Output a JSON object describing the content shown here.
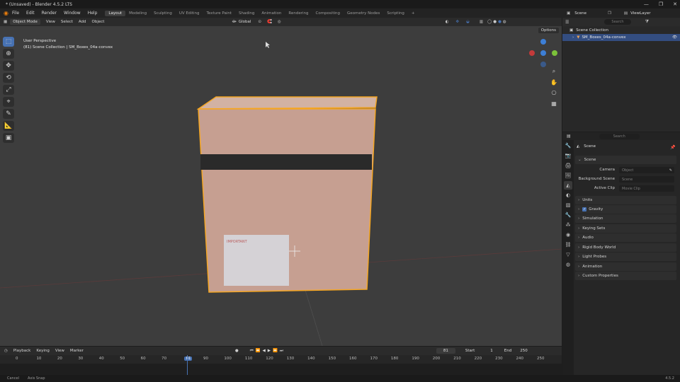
{
  "window": {
    "title": "* (Unsaved) - Blender 4.5.2 LTS",
    "controls": [
      "—",
      "❐",
      "✕"
    ]
  },
  "menu": {
    "items": [
      "File",
      "Edit",
      "Render",
      "Window",
      "Help"
    ]
  },
  "workspaces": [
    {
      "label": "Layout",
      "active": true
    },
    {
      "label": "Modeling"
    },
    {
      "label": "Sculpting"
    },
    {
      "label": "UV Editing"
    },
    {
      "label": "Texture Paint"
    },
    {
      "label": "Shading"
    },
    {
      "label": "Animation"
    },
    {
      "label": "Rendering"
    },
    {
      "label": "Compositing"
    },
    {
      "label": "Geometry Nodes"
    },
    {
      "label": "Scripting"
    },
    {
      "label": "+"
    }
  ],
  "topright": {
    "scene": "Scene",
    "viewlayer": "ViewLayer"
  },
  "viewport_header": {
    "mode": "Object Mode",
    "menus": [
      "View",
      "Select",
      "Add",
      "Object"
    ],
    "orientation": "Global",
    "options": "Options"
  },
  "viewport_overlay": {
    "line1": "User Perspective",
    "line2": "(81) Scene Collection | SM_Boxes_04a-convex"
  },
  "box_label": {
    "title": "IMPORTANT"
  },
  "timeline": {
    "menus": [
      "Playback",
      "Keying",
      "View",
      "Marker"
    ],
    "current_frame": "81",
    "start_label": "Start",
    "start": "1",
    "end_label": "End",
    "end": "250",
    "ticks": [
      "0",
      "10",
      "20",
      "30",
      "40",
      "50",
      "60",
      "70",
      "81",
      "90",
      "100",
      "110",
      "120",
      "130",
      "140",
      "150",
      "160",
      "170",
      "180",
      "190",
      "200",
      "210",
      "220",
      "230",
      "240",
      "250"
    ]
  },
  "outliner": {
    "search_placeholder": "Search",
    "root": "Scene Collection",
    "item": "SM_Boxes_04a-convex"
  },
  "properties": {
    "search_placeholder": "Search",
    "context": "Scene",
    "scene_panel": "Scene",
    "camera_label": "Camera",
    "camera_value": "Object",
    "bg_label": "Background Scene",
    "bg_value": "Scene",
    "clip_label": "Active Clip",
    "clip_value": "Movie Clip",
    "panels": [
      "Units",
      "Gravity",
      "Simulation",
      "Keying Sets",
      "Audio",
      "Rigid Body World",
      "Light Probes",
      "Animation",
      "Custom Properties"
    ]
  },
  "status": {
    "left": "Cancel",
    "axis": "Axis Snap",
    "version": "4.5.2"
  },
  "colors": {
    "accent": "#4772b3",
    "selection": "#f5a623",
    "viewport": "#3d3d3d"
  }
}
